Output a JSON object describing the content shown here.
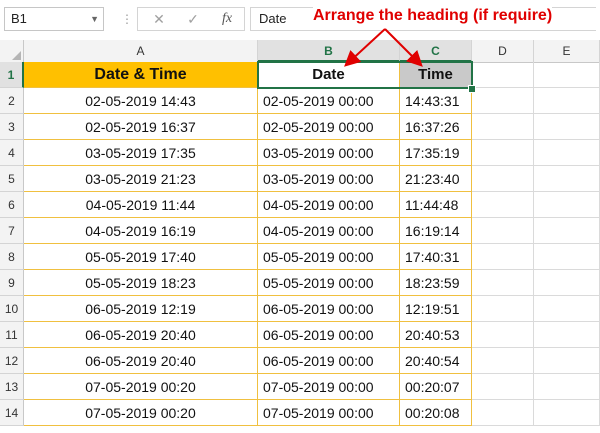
{
  "formula_bar": {
    "name_box": "B1",
    "name_box_caret": "▼",
    "separator": "⋮",
    "cancel_icon": "✕",
    "enter_icon": "✓",
    "fx_label": "fx",
    "content": "Date"
  },
  "annotation": "Arrange the heading (if require)",
  "columns": [
    "A",
    "B",
    "C",
    "D",
    "E"
  ],
  "selected_columns": [
    "B",
    "C"
  ],
  "headers": {
    "a": "Date & Time",
    "b": "Date",
    "c": "Time"
  },
  "rows": [
    {
      "n": "2",
      "a": "02-05-2019 14:43",
      "b": "02-05-2019 00:00",
      "c": "14:43:31"
    },
    {
      "n": "3",
      "a": "02-05-2019 16:37",
      "b": "02-05-2019 00:00",
      "c": "16:37:26"
    },
    {
      "n": "4",
      "a": "03-05-2019 17:35",
      "b": "03-05-2019 00:00",
      "c": "17:35:19"
    },
    {
      "n": "5",
      "a": "03-05-2019 21:23",
      "b": "03-05-2019 00:00",
      "c": "21:23:40"
    },
    {
      "n": "6",
      "a": "04-05-2019 11:44",
      "b": "04-05-2019 00:00",
      "c": "11:44:48"
    },
    {
      "n": "7",
      "a": "04-05-2019 16:19",
      "b": "04-05-2019 00:00",
      "c": "16:19:14"
    },
    {
      "n": "8",
      "a": "05-05-2019 17:40",
      "b": "05-05-2019 00:00",
      "c": "17:40:31"
    },
    {
      "n": "9",
      "a": "05-05-2019 18:23",
      "b": "05-05-2019 00:00",
      "c": "18:23:59"
    },
    {
      "n": "10",
      "a": "06-05-2019 12:19",
      "b": "06-05-2019 00:00",
      "c": "12:19:51"
    },
    {
      "n": "11",
      "a": "06-05-2019 20:40",
      "b": "06-05-2019 00:00",
      "c": "20:40:53"
    },
    {
      "n": "12",
      "a": "06-05-2019 20:40",
      "b": "06-05-2019 00:00",
      "c": "20:40:54"
    },
    {
      "n": "13",
      "a": "07-05-2019 00:20",
      "b": "07-05-2019 00:00",
      "c": "00:20:07"
    },
    {
      "n": "14",
      "a": "07-05-2019 00:20",
      "b": "07-05-2019 00:00",
      "c": "00:20:08"
    }
  ],
  "colors": {
    "accent_green": "#217346",
    "header_orange": "#ffc000",
    "annotation_red": "#e00000",
    "time_header_gray": "#c9c9c9"
  },
  "icons": [
    "dropdown-caret-icon",
    "cancel-icon",
    "enter-icon",
    "insert-function-icon"
  ]
}
